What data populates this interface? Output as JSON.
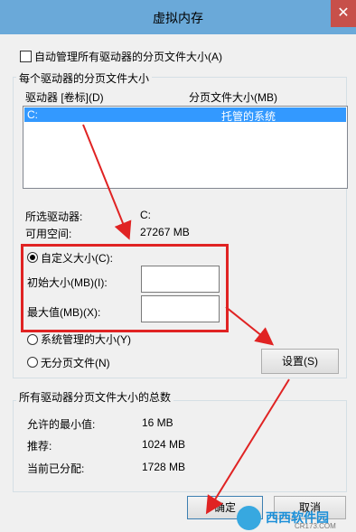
{
  "window": {
    "title": "虚拟内存",
    "close_label": "✕"
  },
  "auto_manage": {
    "label": "自动管理所有驱动器的分页文件大小(A)",
    "checked": false
  },
  "drives_group": {
    "title": "每个驱动器的分页文件大小",
    "col_drive": "驱动器 [卷标](D)",
    "col_size": "分页文件大小(MB)",
    "rows": [
      {
        "drive": "C:",
        "size": "托管的系统",
        "selected": true
      }
    ],
    "selected_drive_label": "所选驱动器:",
    "selected_drive_value": "C:",
    "free_space_label": "可用空间:",
    "free_space_value": "27267 MB",
    "custom_size_label": "自定义大小(C):",
    "initial_size_label": "初始大小(MB)(I):",
    "initial_size_value": "",
    "max_size_label": "最大值(MB)(X):",
    "max_size_value": "",
    "system_managed_label": "系统管理的大小(Y)",
    "no_paging_label": "无分页文件(N)",
    "selected_option": "custom",
    "set_button": "设置(S)"
  },
  "totals_group": {
    "title": "所有驱动器分页文件大小的总数",
    "min_label": "允许的最小值:",
    "min_value": "16 MB",
    "recommended_label": "推荐:",
    "recommended_value": "1024 MB",
    "current_label": "当前已分配:",
    "current_value": "1728 MB"
  },
  "buttons": {
    "ok": "确定",
    "cancel": "取消"
  },
  "watermark": {
    "text": "西西软件园",
    "domain": "CR173.COM"
  },
  "colors": {
    "titlebar": "#6aa9d9",
    "close": "#c7504a",
    "selection": "#3399ff",
    "annotation": "#e02323"
  }
}
